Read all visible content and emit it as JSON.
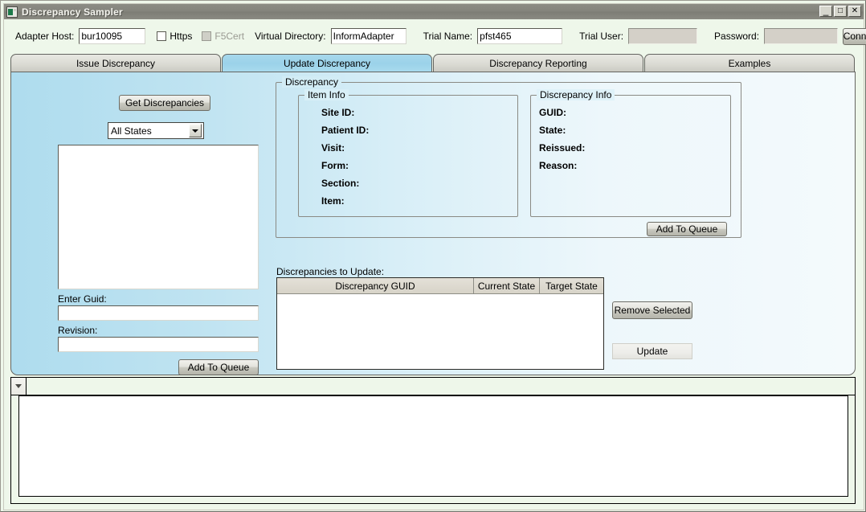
{
  "window": {
    "title": "Discrepancy Sampler",
    "icon": "app-icon",
    "controls": {
      "minimize": "_",
      "maximize": "□",
      "close": "✕"
    }
  },
  "toolbar": {
    "adapter_host_label": "Adapter Host:",
    "adapter_host_value": "bur10095",
    "https_label": "Https",
    "https_checked": false,
    "f5cert_label": "F5Cert",
    "f5cert_checked": false,
    "f5cert_disabled": true,
    "virtual_directory_label": "Virtual Directory:",
    "virtual_directory_value": "InformAdapter",
    "trial_name_label": "Trial Name:",
    "trial_name_value": "pfst465",
    "trial_user_label": "Trial User:",
    "trial_user_value": "",
    "password_label": "Password:",
    "password_value": "",
    "connect_label": "Connect"
  },
  "tabs": [
    {
      "label": "Issue Discrepancy",
      "active": false
    },
    {
      "label": "Update Discrepancy",
      "active": true
    },
    {
      "label": "Discrepancy Reporting",
      "active": false
    },
    {
      "label": "Examples",
      "active": false
    }
  ],
  "left_panel": {
    "get_discrepancies_label": "Get Discrepancies",
    "states_combo_value": "All States",
    "listbox_items": [],
    "enter_guid_label": "Enter Guid:",
    "enter_guid_value": "",
    "revision_label": "Revision:",
    "revision_value": "",
    "add_to_queue_label": "Add To Queue"
  },
  "discrepancy_group": {
    "title": "Discrepancy",
    "item_info": {
      "title": "Item Info",
      "fields": [
        {
          "label": "Site ID:",
          "value": ""
        },
        {
          "label": "Patient ID:",
          "value": ""
        },
        {
          "label": "Visit:",
          "value": ""
        },
        {
          "label": "Form:",
          "value": ""
        },
        {
          "label": "Section:",
          "value": ""
        },
        {
          "label": "Item:",
          "value": ""
        }
      ]
    },
    "discrepancy_info": {
      "title": "Discrepancy Info",
      "fields": [
        {
          "label": "GUID:",
          "value": ""
        },
        {
          "label": "State:",
          "value": ""
        },
        {
          "label": "Reissued:",
          "value": ""
        },
        {
          "label": "Reason:",
          "value": ""
        }
      ]
    },
    "add_to_queue_label": "Add To Queue"
  },
  "queue": {
    "caption": "Discrepancies to Update:",
    "columns": [
      "Discrepancy GUID",
      "Current State",
      "Target State"
    ],
    "rows": [],
    "remove_selected_label": "Remove Selected",
    "update_label": "Update"
  },
  "bottom_panel": {
    "dropdown_icon": "caret-down-icon",
    "log_text": ""
  },
  "colors": {
    "titlebar": "#85857d",
    "form_background": "#eef7ea",
    "tab_active": "#a3d7ec",
    "panel_gradient_start": "#aedcee",
    "panel_gradient_end": "#f4fafc",
    "grid_header": "#d9d5cb"
  }
}
